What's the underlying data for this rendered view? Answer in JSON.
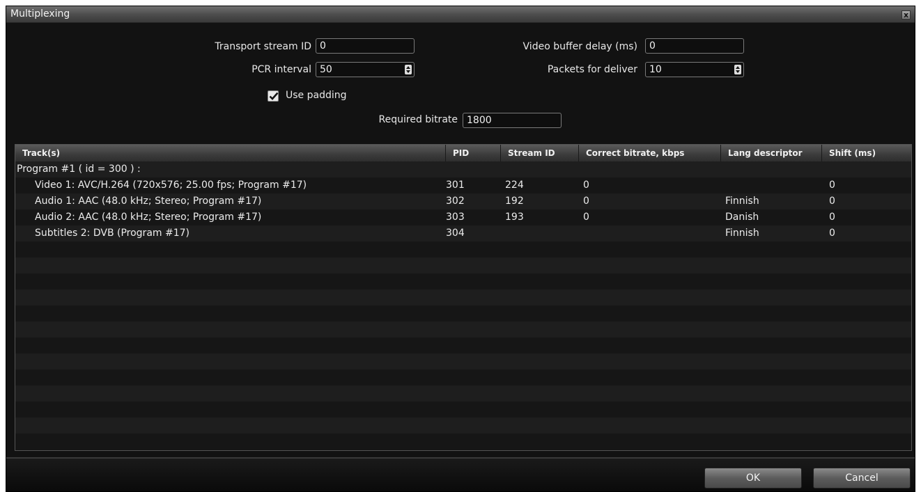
{
  "window": {
    "title": "Multiplexing",
    "close_glyph": "x"
  },
  "form": {
    "transport_stream_id": {
      "label": "Transport stream ID",
      "value": "0"
    },
    "pcr_interval": {
      "label": "PCR interval",
      "value": "50"
    },
    "use_padding": {
      "label": "Use padding",
      "checked": true
    },
    "video_buffer_delay": {
      "label": "Video buffer delay (ms)",
      "value": "0"
    },
    "packets_for_deliver": {
      "label": "Packets for deliver",
      "value": "10"
    },
    "required_bitrate": {
      "label": "Required bitrate",
      "value": "1800"
    }
  },
  "table": {
    "columns": [
      "Track(s)",
      "PID",
      "Stream ID",
      "Correct bitrate, kbps",
      "Lang descriptor",
      "Shift (ms)"
    ],
    "rows": [
      {
        "track": "Program #1 ( id = 300 ) :",
        "pid": "",
        "stream_id": "",
        "bitrate": "",
        "lang": "",
        "shift": ""
      },
      {
        "track": "Video 1: AVC/H.264  (720x576; 25.00 fps; Program #17)",
        "pid": "301",
        "stream_id": "224",
        "bitrate": "0",
        "lang": "",
        "shift": "0"
      },
      {
        "track": "Audio 1: AAC  (48.0 kHz; Stereo; Program #17)",
        "pid": "302",
        "stream_id": "192",
        "bitrate": "0",
        "lang": "Finnish",
        "shift": "0"
      },
      {
        "track": "Audio 2: AAC  (48.0 kHz; Stereo; Program #17)",
        "pid": "303",
        "stream_id": "193",
        "bitrate": "0",
        "lang": "Danish",
        "shift": "0"
      },
      {
        "track": "Subtitles 2: DVB  (Program #17)",
        "pid": "304",
        "stream_id": "",
        "bitrate": "",
        "lang": "Finnish",
        "shift": "0"
      }
    ]
  },
  "buttons": {
    "ok": "OK",
    "cancel": "Cancel"
  },
  "colors": {
    "background": "#121212",
    "header": "#3b3b3b",
    "text": "#e6e6e6"
  }
}
